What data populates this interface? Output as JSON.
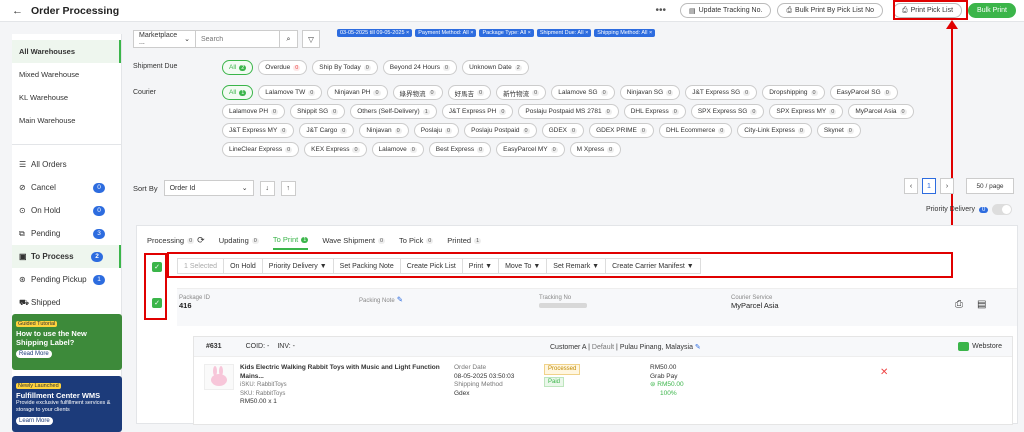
{
  "header": {
    "back_icon": "←",
    "title": "Order Processing",
    "more": "•••",
    "update_tracking": "Update Tracking No.",
    "bulk_print_pick": "Bulk Print By Pick List No",
    "print_pick_list": "Print Pick List",
    "bulk_print": "Bulk Print"
  },
  "sidebar": {
    "warehouses": [
      "All Warehouses",
      "Mixed Warehouse",
      "KL Warehouse",
      "Main Warehouse"
    ],
    "statuses": [
      {
        "icon": "☰",
        "label": "All Orders",
        "count": ""
      },
      {
        "icon": "⊘",
        "label": "Cancel",
        "count": "0"
      },
      {
        "icon": "⊙",
        "label": "On Hold",
        "count": "0"
      },
      {
        "icon": "⧉",
        "label": "Pending",
        "count": "3"
      },
      {
        "icon": "▣",
        "label": "To Process",
        "count": "2"
      },
      {
        "icon": "⊛",
        "label": "Pending Pickup",
        "count": "1"
      },
      {
        "icon": "⛟",
        "label": "Shipped",
        "count": ""
      }
    ],
    "promo1": {
      "tag": "Guided Tutorial",
      "title": "How to use the New Shipping Label?",
      "read": "Read More"
    },
    "promo2": {
      "tag": "Newly Launched",
      "title": "Fulfillment Center WMS",
      "sub": "Provide exclusive fulfillment services & storage to your clients",
      "read": "Learn More"
    }
  },
  "filters": {
    "marketplace": "Marketplace ...",
    "search_placeholder": "Search",
    "tags": [
      "03-05-2025 till 09-05-2025 ×",
      "Payment Method: All ×",
      "Package Type: All ×",
      "Shipment Due: All ×",
      "Shipping Method: All ×"
    ],
    "shipment_due_label": "Shipment Due",
    "shipment_due": [
      {
        "label": "All",
        "n": "2",
        "on": true
      },
      {
        "label": "Overdue",
        "n": "0",
        "red": true
      },
      {
        "label": "Ship By Today",
        "n": "0"
      },
      {
        "label": "Beyond 24 Hours",
        "n": "0"
      },
      {
        "label": "Unknown Date",
        "n": "2"
      }
    ],
    "courier_label": "Courier",
    "couriers": [
      {
        "label": "All",
        "n": "1",
        "on": true
      },
      {
        "label": "Lalamove TW",
        "n": "0"
      },
      {
        "label": "Ninjavan PH",
        "n": "0"
      },
      {
        "label": "綠界物流",
        "n": "0"
      },
      {
        "label": "好馬吉",
        "n": "0"
      },
      {
        "label": "新竹物流",
        "n": "0"
      },
      {
        "label": "Lalamove SG",
        "n": "0"
      },
      {
        "label": "Ninjavan SG",
        "n": "0"
      },
      {
        "label": "J&T Express SG",
        "n": "0"
      },
      {
        "label": "Dropshipping",
        "n": "0"
      },
      {
        "label": "EasyParcel SG",
        "n": "0"
      },
      {
        "label": "Lalamove PH",
        "n": "0"
      },
      {
        "label": "Shippit SG",
        "n": "0"
      },
      {
        "label": "Others (Self-Delivery)",
        "n": "1"
      },
      {
        "label": "J&T Express PH",
        "n": "0"
      },
      {
        "label": "Poslaju Postpaid MS 2781",
        "n": "0"
      },
      {
        "label": "DHL Express",
        "n": "0"
      },
      {
        "label": "SPX Express SG",
        "n": "0"
      },
      {
        "label": "SPX Express MY",
        "n": "0"
      },
      {
        "label": "MyParcel Asia",
        "n": "0"
      },
      {
        "label": "J&T Express MY",
        "n": "0"
      },
      {
        "label": "J&T Cargo",
        "n": "0"
      },
      {
        "label": "Ninjavan",
        "n": "0"
      },
      {
        "label": "Poslaju",
        "n": "0"
      },
      {
        "label": "Poslaju Postpaid",
        "n": "0"
      },
      {
        "label": "GDEX",
        "n": "0"
      },
      {
        "label": "GDEX PRIME",
        "n": "0"
      },
      {
        "label": "DHL Ecommerce",
        "n": "0"
      },
      {
        "label": "City-Link Express",
        "n": "0"
      },
      {
        "label": "Skynet",
        "n": "0"
      },
      {
        "label": "LineClear Express",
        "n": "0"
      },
      {
        "label": "KEX Express",
        "n": "0"
      },
      {
        "label": "Lalamove",
        "n": "0"
      },
      {
        "label": "Best Express",
        "n": "0"
      },
      {
        "label": "EasyParcel MY",
        "n": "0"
      },
      {
        "label": "M Xpress",
        "n": "0"
      }
    ]
  },
  "sort": {
    "label": "Sort By",
    "value": "Order Id"
  },
  "pager": {
    "page": "1",
    "per_page": "50 / page"
  },
  "priority": {
    "label": "Priority Delivery",
    "n": "0"
  },
  "tabs": [
    {
      "label": "Processing",
      "n": "0"
    },
    {
      "label": "Updating",
      "n": "0"
    },
    {
      "label": "To Print",
      "n": "1",
      "active": true
    },
    {
      "label": "Wave Shipment",
      "n": "0"
    },
    {
      "label": "To Pick",
      "n": "0"
    },
    {
      "label": "Printed",
      "n": "1"
    }
  ],
  "actions": [
    "1 Selected",
    "On Hold",
    "Priority Delivery ▼",
    "Set Packing Note",
    "Create Pick List",
    "Print ▼",
    "Move To ▼",
    "Set Remark ▼",
    "Create Carrier Manifest ▼"
  ],
  "package": {
    "id_label": "Package ID",
    "id": "416",
    "note_label": "Packing Note",
    "tracking_label": "Tracking No",
    "courier_label": "Courier Service",
    "courier": "MyParcel Asia"
  },
  "order": {
    "no": "#631",
    "cod": "COID: -",
    "inv": "INV: -",
    "customer": "Customer A",
    "default": "Default",
    "location": "Pulau Pinang, Malaysia",
    "source": "Webstore",
    "product": "Kids Electric Walking Rabbit Toys with Music and Light Function Mains...",
    "sku1": "iSKU: RabbitToys",
    "sku2": "SKU: RabbitToys",
    "price": "RM50.00",
    "qty": "x 1",
    "date_label": "Order Date",
    "date": "08-05-2025 03:50:03",
    "ship_label": "Shipping Method",
    "ship": "Gdex",
    "status": "Processed",
    "paid": "Paid",
    "total": "RM50.00",
    "pay_method": "Grab Pay",
    "paid_amount": "RM50.00",
    "pct": "100%"
  }
}
